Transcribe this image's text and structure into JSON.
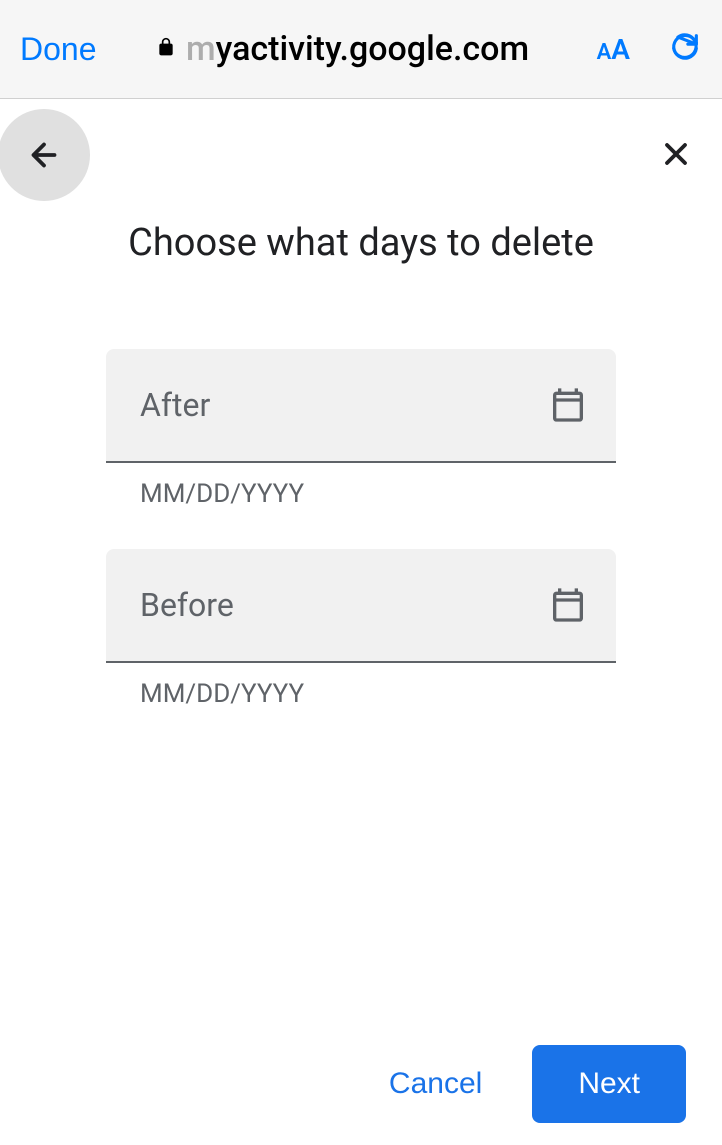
{
  "browser": {
    "done_label": "Done",
    "url_faded": "m",
    "url_visible": "yactivity.google.com"
  },
  "header": {
    "title": "Choose what days to delete"
  },
  "form": {
    "after": {
      "label": "After",
      "hint": "MM/DD/YYYY"
    },
    "before": {
      "label": "Before",
      "hint": "MM/DD/YYYY"
    }
  },
  "footer": {
    "cancel_label": "Cancel",
    "next_label": "Next"
  }
}
